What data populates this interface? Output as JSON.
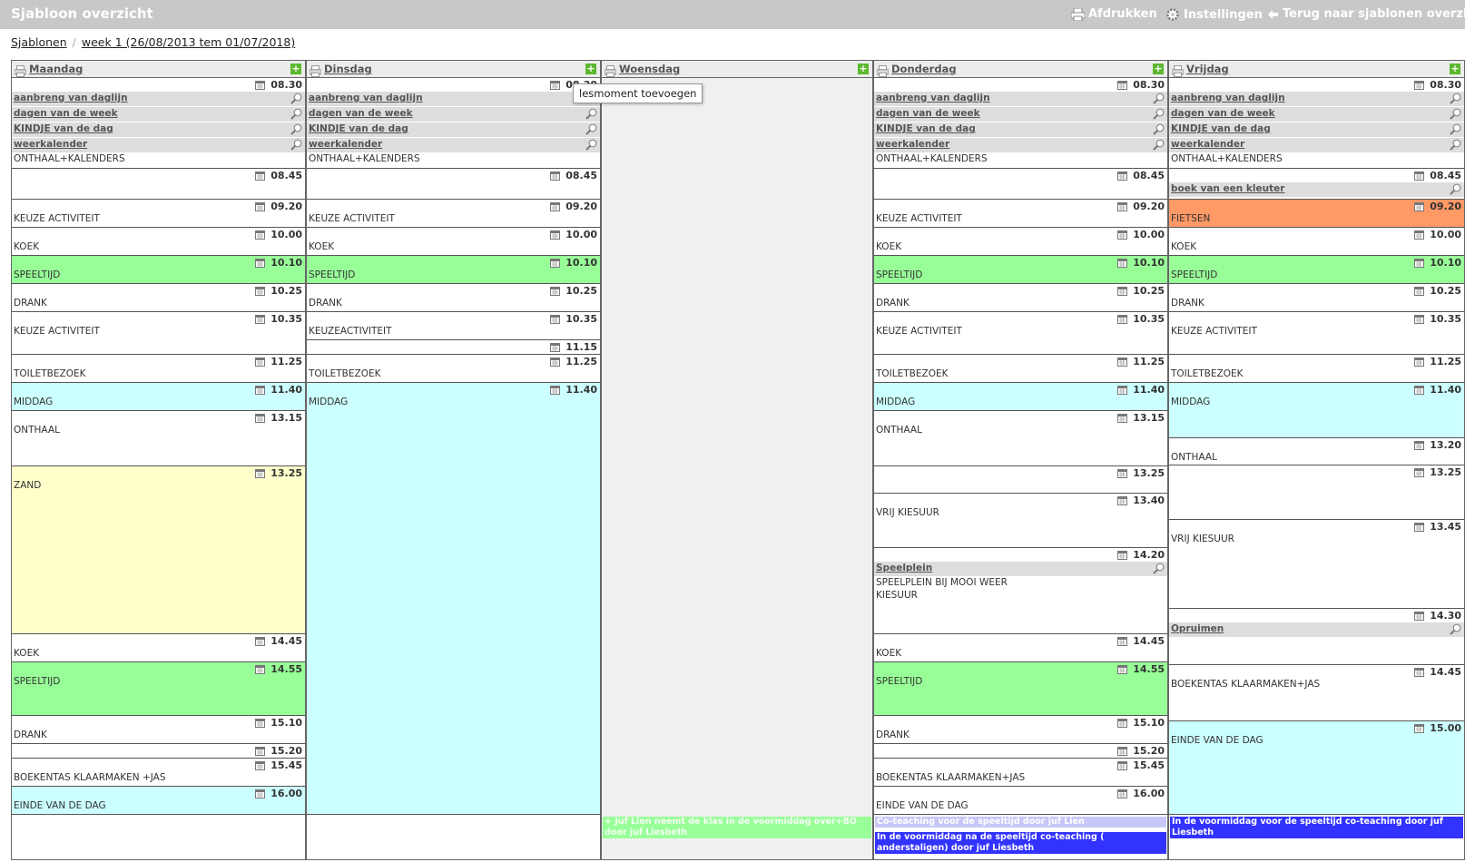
{
  "header": {
    "title": "Sjabloon overzicht",
    "actions": [
      {
        "label": "Afdrukken",
        "icon": "printer-icon"
      },
      {
        "label": "Instellingen",
        "icon": "gear-icon"
      },
      {
        "label": "Terug naar sjablonen overzicht",
        "icon": "arrow-left-icon"
      }
    ]
  },
  "breadcrumb": [
    "Sjablonen",
    "week 1 (26/08/2013 tem 01/07/2018)"
  ],
  "tooltip": "lesmoment toevoegen",
  "colors": {
    "green": "#98ff98",
    "cyan": "#ccffff",
    "yellow": "#ffffcc",
    "orange": "#ff9966",
    "note_green": "#99ff99",
    "note_lavender": "#c8c8f8",
    "note_blue": "#3333ff"
  },
  "days": [
    {
      "name": "Maandag",
      "slots": [
        {
          "time": "08.30",
          "activities": [
            "aanbreng van daglijn",
            "dagen van de week",
            "KINDJE van de dag",
            "weerkalender"
          ],
          "label": "ONTHAAL+KALENDERS"
        },
        {
          "time": "08.45",
          "activities": [],
          "label": ""
        },
        {
          "time": "09.20",
          "activities": [],
          "label": "KEUZE ACTIVITEIT"
        },
        {
          "time": "10.00",
          "activities": [],
          "label": "KOEK"
        },
        {
          "time": "10.10",
          "activities": [],
          "label": "SPEELTIJD",
          "color": "green"
        },
        {
          "time": "10.25",
          "activities": [],
          "label": "DRANK"
        },
        {
          "time": "10.35",
          "activities": [],
          "label": "KEUZE ACTIVITEIT"
        },
        {
          "time": "11.25",
          "activities": [],
          "label": "TOILETBEZOEK"
        },
        {
          "time": "11.40",
          "activities": [],
          "label": "MIDDAG",
          "color": "cyan"
        },
        {
          "time": "13.15",
          "activities": [],
          "label": "ONTHAAL"
        },
        {
          "time": "13.25",
          "activities": [],
          "label": "ZAND",
          "color": "yellow"
        },
        {
          "time": "14.45",
          "activities": [],
          "label": "KOEK"
        },
        {
          "time": "14.55",
          "activities": [],
          "label": "SPEELTIJD",
          "color": "green"
        },
        {
          "time": "15.10",
          "activities": [],
          "label": "DRANK"
        },
        {
          "time": "15.20",
          "activities": [],
          "label": ""
        },
        {
          "time": "15.45",
          "activities": [],
          "label": "BOEKENTAS KLAARMAKEN +JAS"
        },
        {
          "time": "16.00",
          "activities": [],
          "label": "EINDE VAN DE DAG",
          "color": "cyan"
        }
      ],
      "notes": []
    },
    {
      "name": "Dinsdag",
      "slots": [
        {
          "time": "08.30",
          "activities": [
            "aanbreng van daglijn",
            "dagen van de week",
            "KINDJE van de dag",
            "weerkalender"
          ],
          "label": "ONTHAAL+KALENDERS"
        },
        {
          "time": "08.45",
          "activities": [],
          "label": ""
        },
        {
          "time": "09.20",
          "activities": [],
          "label": "KEUZE ACTIVITEIT"
        },
        {
          "time": "10.00",
          "activities": [],
          "label": "KOEK"
        },
        {
          "time": "10.10",
          "activities": [],
          "label": "SPEELTIJD",
          "color": "green"
        },
        {
          "time": "10.25",
          "activities": [],
          "label": "DRANK"
        },
        {
          "time": "10.35",
          "activities": [],
          "label": "KEUZEACTIVITEIT"
        },
        {
          "time": "11.15",
          "activities": [],
          "label": ""
        },
        {
          "time": "11.25",
          "activities": [],
          "label": "TOILETBEZOEK"
        },
        {
          "time": "11.40",
          "activities": [],
          "label": "MIDDAG",
          "color": "cyan"
        }
      ],
      "notes": []
    },
    {
      "name": "Woensdag",
      "slots": [],
      "notes": [
        {
          "text": "+ Juf Lien neemt de klas in de voormiddag over+BO door juf Liesbeth",
          "color": "note_green"
        }
      ]
    },
    {
      "name": "Donderdag",
      "slots": [
        {
          "time": "08.30",
          "activities": [
            "aanbreng van daglijn",
            "dagen van de week",
            "KINDJE van de dag",
            "weerkalender"
          ],
          "label": "ONTHAAL+KALENDERS"
        },
        {
          "time": "08.45",
          "activities": [],
          "label": ""
        },
        {
          "time": "09.20",
          "activities": [],
          "label": "KEUZE ACTIVITEIT"
        },
        {
          "time": "10.00",
          "activities": [],
          "label": "KOEK"
        },
        {
          "time": "10.10",
          "activities": [],
          "label": "SPEELTIJD",
          "color": "green"
        },
        {
          "time": "10.25",
          "activities": [],
          "label": "DRANK"
        },
        {
          "time": "10.35",
          "activities": [],
          "label": "KEUZE ACTIVITEIT"
        },
        {
          "time": "11.25",
          "activities": [],
          "label": "TOILETBEZOEK"
        },
        {
          "time": "11.40",
          "activities": [],
          "label": "MIDDAG",
          "color": "cyan"
        },
        {
          "time": "13.15",
          "activities": [],
          "label": "ONTHAAL"
        },
        {
          "time": "13.25",
          "activities": [],
          "label": ""
        },
        {
          "time": "13.40",
          "activities": [],
          "label": "VRIJ KIESUUR"
        },
        {
          "time": "14.20",
          "activities": [
            "Speelplein"
          ],
          "label": "SPEELPLEIN BIJ MOOI WEER\nKIESUUR"
        },
        {
          "time": "14.45",
          "activities": [],
          "label": "KOEK"
        },
        {
          "time": "14.55",
          "activities": [],
          "label": "SPEELTIJD",
          "color": "green"
        },
        {
          "time": "15.10",
          "activities": [],
          "label": "DRANK"
        },
        {
          "time": "15.20",
          "activities": [],
          "label": ""
        },
        {
          "time": "15.45",
          "activities": [],
          "label": "BOEKENTAS KLAARMAKEN+JAS"
        },
        {
          "time": "16.00",
          "activities": [],
          "label": "EINDE VAN DE DAG"
        }
      ],
      "notes": [
        {
          "text": "Co-teaching voor de speeltijd door juf Lien",
          "color": "note_lavender"
        },
        {
          "text": "In de voormiddag na de speeltijd co-teaching ( anderstaligen) door juf Liesbeth",
          "color": "note_blue"
        }
      ]
    },
    {
      "name": "Vrijdag",
      "slots": [
        {
          "time": "08.30",
          "activities": [
            "aanbreng van daglijn",
            "dagen van de week",
            "KINDJE van de dag",
            "weerkalender"
          ],
          "label": "ONTHAAL+KALENDERS"
        },
        {
          "time": "08.45",
          "activities": [
            "boek van een kleuter"
          ],
          "label": ""
        },
        {
          "time": "09.20",
          "activities": [],
          "label": "FIETSEN",
          "color": "orange"
        },
        {
          "time": "10.00",
          "activities": [],
          "label": "KOEK"
        },
        {
          "time": "10.10",
          "activities": [],
          "label": "SPEELTIJD",
          "color": "green"
        },
        {
          "time": "10.25",
          "activities": [],
          "label": "DRANK"
        },
        {
          "time": "10.35",
          "activities": [],
          "label": "KEUZE ACTIVITEIT"
        },
        {
          "time": "11.25",
          "activities": [],
          "label": "TOILETBEZOEK"
        },
        {
          "time": "11.40",
          "activities": [],
          "label": "MIDDAG",
          "color": "cyan"
        },
        {
          "time": "13.20",
          "activities": [],
          "label": "ONTHAAL"
        },
        {
          "time": "13.25",
          "activities": [],
          "label": ""
        },
        {
          "time": "13.45",
          "activities": [],
          "label": "VRIJ KIESUUR"
        },
        {
          "time": "14.30",
          "activities": [
            "Opruimen"
          ],
          "label": ""
        },
        {
          "time": "14.45",
          "activities": [],
          "label": "BOEKENTAS KLAARMAKEN+JAS"
        },
        {
          "time": "15.00",
          "activities": [],
          "label": "EINDE VAN DE DAG",
          "color": "cyan"
        }
      ],
      "notes": [
        {
          "text": "In de voormiddag voor de speeltijd co-teaching door juf Liesbeth",
          "color": "note_blue"
        }
      ]
    }
  ]
}
